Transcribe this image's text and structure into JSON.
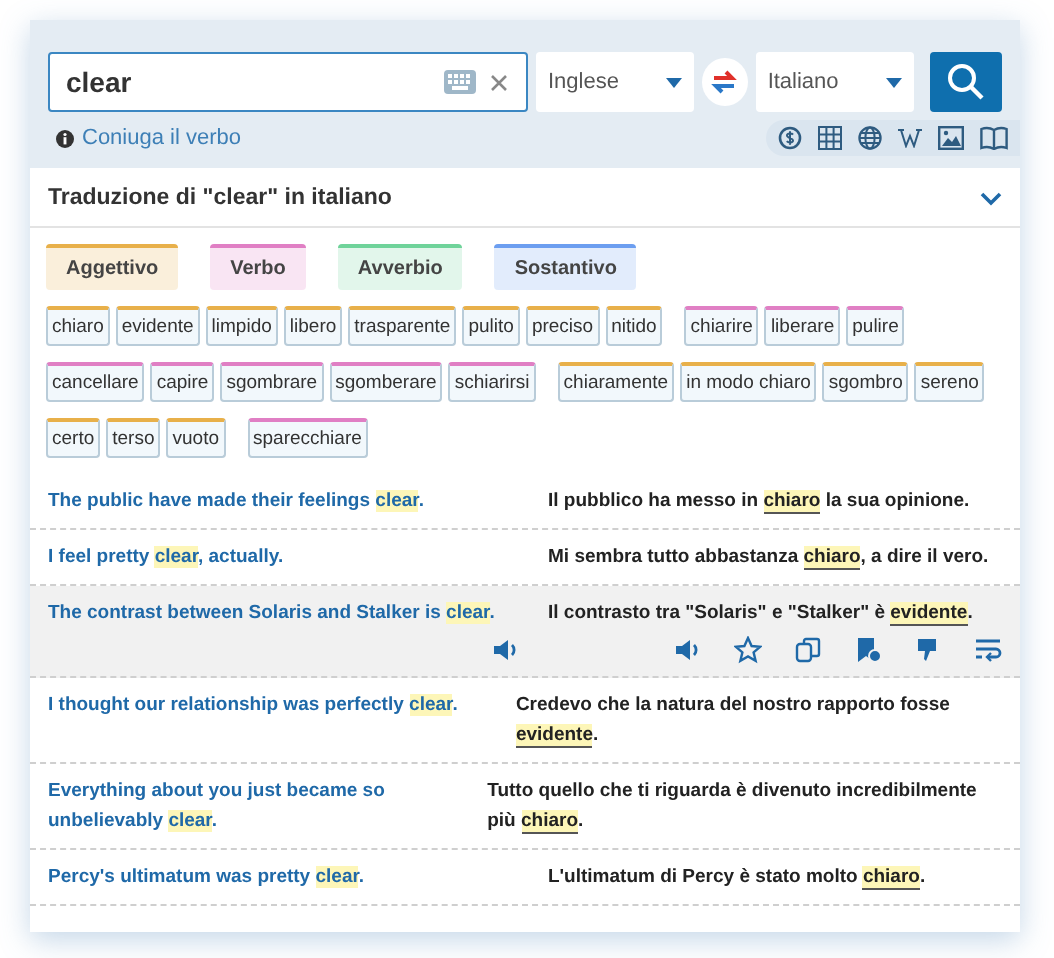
{
  "search": {
    "value": "clear",
    "source_language": "Inglese",
    "target_language": "Italiano"
  },
  "conjugate_link": "Coniuga il verbo",
  "section_title": "Traduzione di \"clear\" in italiano",
  "categories": [
    {
      "label": "Aggettivo",
      "color": "#e8b04a"
    },
    {
      "label": "Verbo",
      "color": "#e07fc4"
    },
    {
      "label": "Avverbio",
      "color": "#6fd39a"
    },
    {
      "label": "Sostantivo",
      "color": "#6c9ef0"
    }
  ],
  "tag_rows": [
    [
      {
        "text": "chiaro",
        "color": "#e8b04a"
      },
      {
        "text": "evidente",
        "color": "#e8b04a"
      },
      {
        "text": "limpido",
        "color": "#e8b04a"
      },
      {
        "text": "libero",
        "color": "#e8b04a"
      },
      {
        "text": "trasparente",
        "color": "#e8b04a"
      },
      {
        "text": "pulito",
        "color": "#e8b04a"
      },
      {
        "text": "preciso",
        "color": "#e8b04a"
      },
      {
        "text": "nitido",
        "color": "#e8b04a"
      },
      {
        "text": "chiarire",
        "color": "#e07fc4"
      },
      {
        "text": "liberare",
        "color": "#e07fc4"
      },
      {
        "text": "pulire",
        "color": "#e07fc4"
      }
    ],
    [
      {
        "text": "cancellare",
        "color": "#e07fc4"
      },
      {
        "text": "capire",
        "color": "#e07fc4"
      },
      {
        "text": "sgombrare",
        "color": "#e07fc4"
      },
      {
        "text": "sgomberare",
        "color": "#e07fc4"
      },
      {
        "text": "schiarirsi",
        "color": "#e07fc4"
      },
      {
        "text": "chiaramente",
        "color": "#e8b04a"
      },
      {
        "text": "in modo chiaro",
        "color": "#e8b04a"
      },
      {
        "text": "sgombro",
        "color": "#e8b04a"
      },
      {
        "text": "sereno",
        "color": "#e8b04a"
      }
    ],
    [
      {
        "text": "certo",
        "color": "#e8b04a"
      },
      {
        "text": "terso",
        "color": "#e8b04a"
      },
      {
        "text": "vuoto",
        "color": "#e8b04a"
      },
      {
        "text": "sparecchiare",
        "color": "#e07fc4"
      }
    ]
  ],
  "examples": [
    {
      "hovered": false,
      "source": {
        "before": "The public have made their feelings ",
        "match": "clear",
        "after": "."
      },
      "target": {
        "before": "Il pubblico ha messo in ",
        "match": "chiaro",
        "after": " la sua opinione."
      }
    },
    {
      "hovered": false,
      "source": {
        "before": "I feel pretty ",
        "match": "clear",
        "after": ", actually."
      },
      "target": {
        "before": "Mi sembra tutto abbastanza ",
        "match": "chiaro",
        "after": ", a dire il vero."
      }
    },
    {
      "hovered": true,
      "source": {
        "before": "The contrast between Solaris and Stalker is ",
        "match": "clear",
        "after": "."
      },
      "target": {
        "before": "Il contrasto tra \"Solaris\" e \"Stalker\" è ",
        "match": "evidente",
        "after": "."
      }
    },
    {
      "hovered": false,
      "source": {
        "before": "I thought our relationship was perfectly ",
        "match": "clear",
        "after": "."
      },
      "target": {
        "before": "Credevo che la natura del nostro rapporto fosse ",
        "match": "evidente",
        "after": "."
      }
    },
    {
      "hovered": false,
      "source": {
        "before": "Everything about you just became so unbelievably ",
        "match": "clear",
        "after": "."
      },
      "target": {
        "before": "Tutto quello che ti riguarda è divenuto incredibilmente più ",
        "match": "chiaro",
        "after": "."
      }
    },
    {
      "hovered": false,
      "source": {
        "before": "Percy's ultimatum was pretty ",
        "match": "clear",
        "after": "."
      },
      "target": {
        "before": "L'ultimatum di Percy è stato molto ",
        "match": "chiaro",
        "after": "."
      }
    }
  ]
}
